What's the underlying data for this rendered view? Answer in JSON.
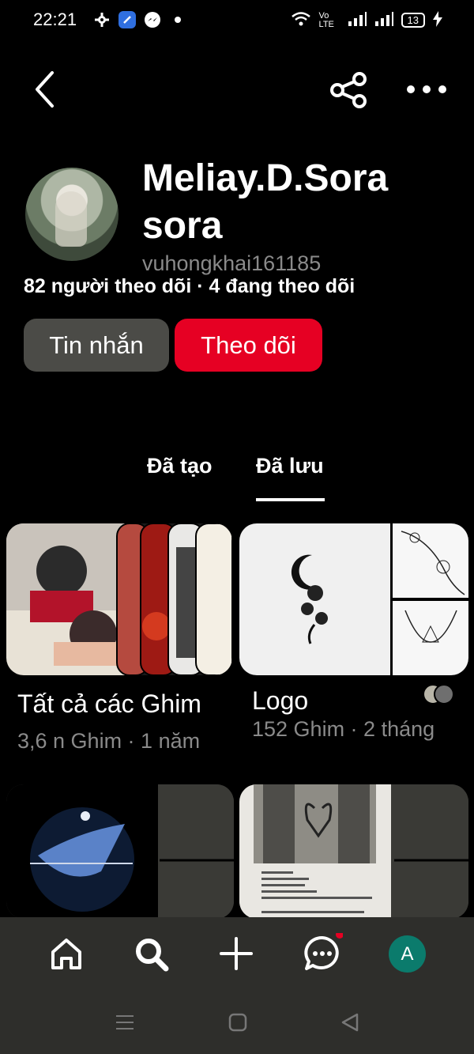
{
  "status_bar": {
    "time": "22:21",
    "battery": "13",
    "network_label": "Vo LTE"
  },
  "profile": {
    "name": "Meliay.D.Sora sora",
    "username": "vuhongkhai161185",
    "follow_stats": "82 người theo dõi · 4 đang theo dõi"
  },
  "actions": {
    "message_label": "Tin nhắn",
    "follow_label": "Theo dõi"
  },
  "tabs": [
    {
      "label": "Đã tạo"
    },
    {
      "label": "Đã lưu"
    }
  ],
  "boards": [
    {
      "title": "Tất cả các Ghim",
      "meta": "3,6 n Ghim · 1 năm"
    },
    {
      "title": "Logo",
      "meta": "152 Ghim · 2 tháng"
    }
  ],
  "nav": {
    "avatar_letter": "A"
  },
  "colors": {
    "accent": "#e60023",
    "secondary_button": "#4b4b47",
    "nav_bg": "#2e2e2b",
    "avatar_bg": "#0b7b6c"
  }
}
